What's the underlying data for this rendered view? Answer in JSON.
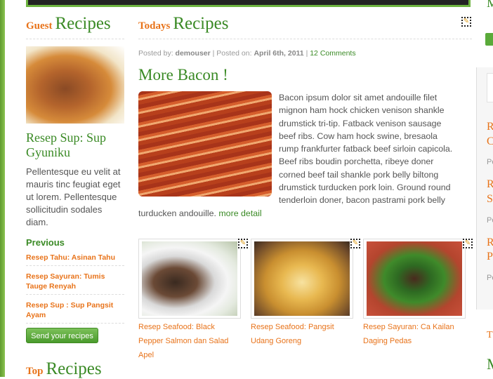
{
  "colors": {
    "green": "#3a8a25",
    "orange": "#e8731a",
    "text": "#555555"
  },
  "guest": {
    "heading_small": "Guest",
    "heading_big": "Recipes",
    "title": "Resep Sup: Sup Gyuniku",
    "excerpt": "Pellentesque eu velit at mauris tinc feugiat eget ut lorem. Pellentesque sollicitudin sodales diam.",
    "previous_label": "Previous",
    "previous_items": [
      "Resep Tahu: Asinan Tahu",
      "Resep Sayuran: Tumis Tauge Renyah",
      "Resep Sup : Sup Pangsit Ayam"
    ],
    "send_button": "Send your recipes"
  },
  "top": {
    "heading_small": "Top",
    "heading_big": "Recipes"
  },
  "today": {
    "heading_small": "Todays",
    "heading_big": "Recipes",
    "meta": {
      "posted_by_label": "Posted by:",
      "author": "demouser",
      "posted_on_label": "| Posted on:",
      "date": "April 6th, 2011",
      "sep": "|",
      "comments": "12 Comments"
    },
    "post_title": "More Bacon !",
    "body": "Bacon ipsum dolor sit amet andouille filet mignon ham hock chicken venison shankle drumstick tri-tip. Fatback venison sausage beef ribs. Cow ham hock swine, bresaola rump frankfurter fatback beef sirloin capicola. Beef ribs boudin porchetta, ribeye doner corned beef tail shankle pork belly biltong drumstick turducken pork loin. Ground round tenderloin doner, bacon pastrami pork belly turducken andouille.",
    "more_link": "more detail"
  },
  "thumbs": [
    {
      "caption": "Resep Seafood: Black Pepper Salmon dan Salad Apel"
    },
    {
      "caption": "Resep Seafood: Pangsit Udang Goreng"
    },
    {
      "caption": "Resep Sayuran: Ca Kailan Daging Pedas"
    }
  ],
  "right_sidebar": {
    "frags": [
      "M",
      "R",
      "C",
      "Pe",
      "R",
      "S",
      "Pe",
      "R",
      "P",
      "Pe",
      "T",
      "M"
    ]
  },
  "icons": {
    "edit": "pencil-edit-icon"
  }
}
